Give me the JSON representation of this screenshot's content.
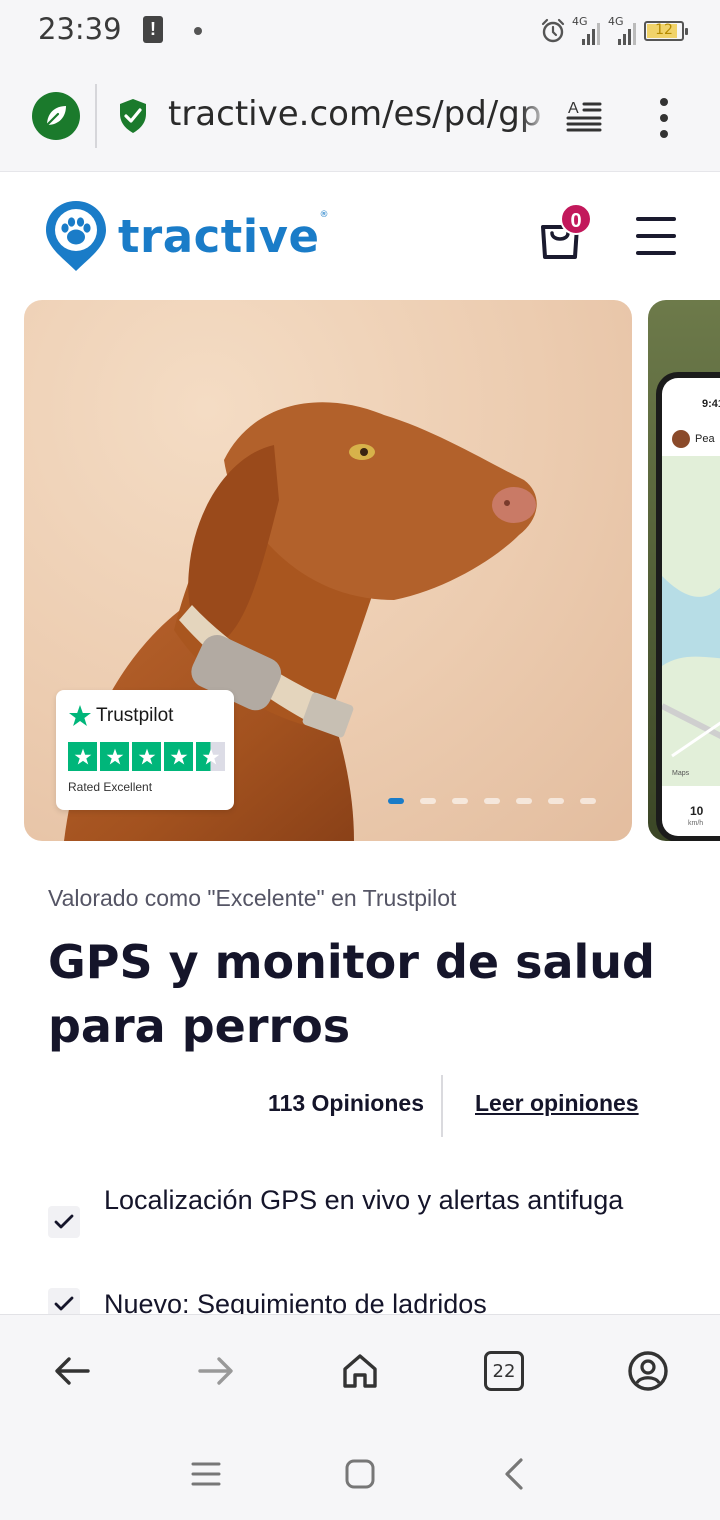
{
  "status_bar": {
    "time": "23:39",
    "battery": "12",
    "network1": "4G",
    "network2": "4G"
  },
  "browser": {
    "url": "tractive.com/es/pd/gps",
    "tabs_count": "22"
  },
  "site": {
    "logo_text": "tractive",
    "cart_count": "0"
  },
  "hero": {
    "trustpilot_brand": "Trustpilot",
    "trustpilot_rating": "Rated Excellent",
    "slide_count": 7,
    "active_slide": 1,
    "phone_time": "9:41",
    "phone_name": "Pea",
    "phone_speed": "10",
    "phone_speed_unit": "km/h",
    "phone_map_label": "Maps"
  },
  "product": {
    "rated_line": "Valorado como \"Excelente\" en Trustpilot",
    "title": "GPS y monitor de salud para perros",
    "reviews_count": "113 Opiniones",
    "reviews_link": "Leer opiniones",
    "features": [
      "Localización GPS en vivo y alertas antifuga",
      "Nuevo: Seguimiento de ladridos"
    ]
  },
  "colors": {
    "brand_blue": "#1a7cc8",
    "badge_red": "#c2185b",
    "trustpilot_green": "#00b67a",
    "leaf_green": "#1b7a2c"
  }
}
